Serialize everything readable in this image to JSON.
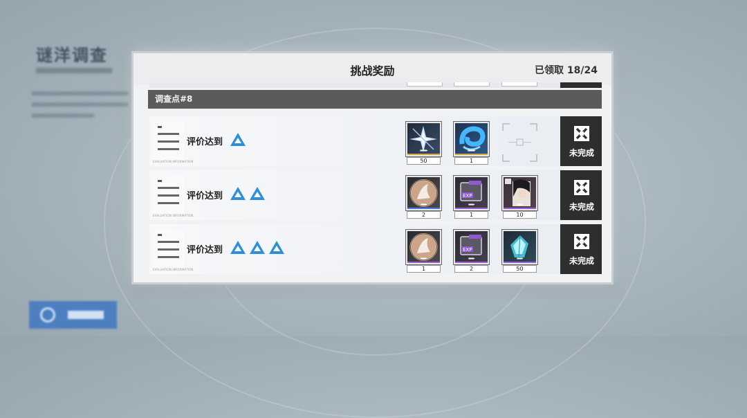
{
  "background": {
    "title": "谜洋调查"
  },
  "panel": {
    "title": "挑战奖励",
    "status": "已领取 18/24"
  },
  "section": {
    "header": "调查点#8"
  },
  "rows": [
    {
      "label": "评价达到",
      "triangles": 1,
      "caption": "EVALUATION INFORMATION",
      "rewards": [
        {
          "icon": "crystal-shard-icon",
          "count": "50",
          "stripe": "#d5a64a"
        },
        {
          "icon": "blue-swirl-icon",
          "count": "1",
          "stripe": "#d5a64a"
        }
      ],
      "status": "未完成"
    },
    {
      "label": "评价达到",
      "triangles": 2,
      "caption": "EVALUATION INFORMATION",
      "rewards": [
        {
          "icon": "character-badge-icon",
          "count": "2",
          "stripe": "#4a7ad8"
        },
        {
          "icon": "exp-card-icon",
          "count": "1",
          "stripe": "#9a5ed0"
        },
        {
          "icon": "character-portrait-icon",
          "count": "10",
          "stripe": "#9a5ed0"
        }
      ],
      "status": "未完成"
    },
    {
      "label": "评价达到",
      "triangles": 3,
      "caption": "EVALUATION INFORMATION",
      "rewards": [
        {
          "icon": "character-badge-icon",
          "count": "1",
          "stripe": "#9a5ed0"
        },
        {
          "icon": "exp-card-icon",
          "count": "2",
          "stripe": "#9a5ed0"
        },
        {
          "icon": "cyan-crystal-icon",
          "count": "50",
          "stripe": "#9a5ed0"
        }
      ],
      "status": "未完成"
    }
  ],
  "colors": {
    "triangle": "#2e8fd8",
    "claim_bg": "#2e2e2e",
    "section_bg": "#5b5b5b"
  }
}
